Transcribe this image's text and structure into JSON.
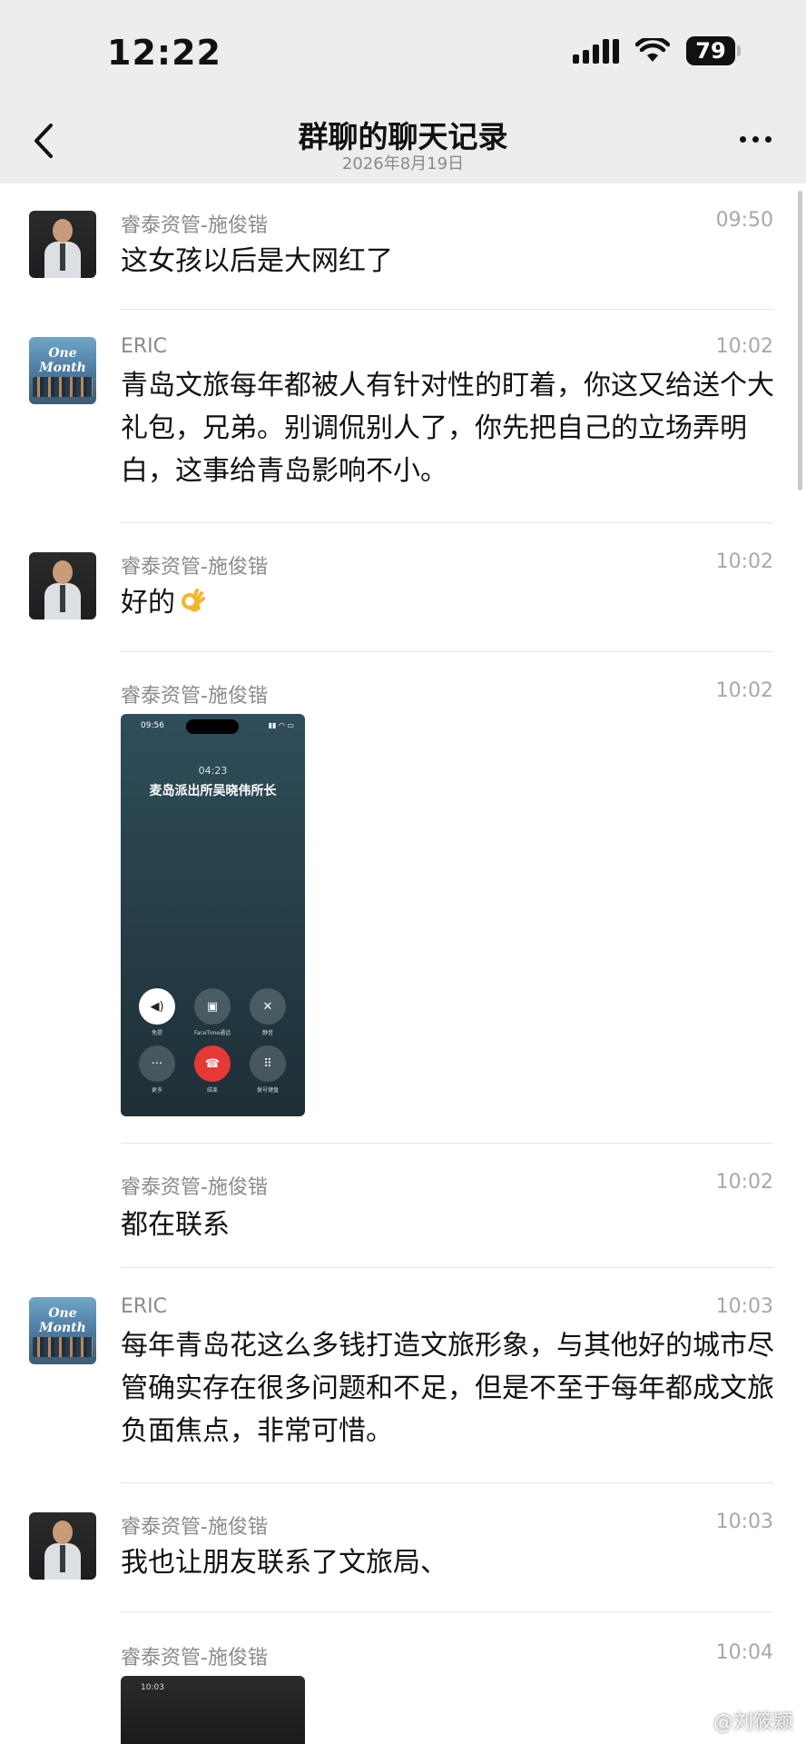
{
  "status_bar": {
    "time": "12:22",
    "battery": "79"
  },
  "nav": {
    "title": "群聊的聊天记录",
    "date": "2026年8月19日"
  },
  "messages": [
    {
      "sender": "睿泰资管-施俊锴",
      "time": "09:50",
      "text": "这女孩以后是大网红了"
    },
    {
      "sender": "ERIC",
      "time": "10:02",
      "text": "青岛文旅每年都被人有针对性的盯着，你这又给送个大礼包，兄弟。别调侃别人了，你先把自己的立场弄明白，这事给青岛影响不小。"
    },
    {
      "sender": "睿泰资管-施俊锴",
      "time": "10:02",
      "text": "好的",
      "emoji": "ok-hand-emoji"
    },
    {
      "sender": "睿泰资管-施俊锴",
      "time": "10:02",
      "image": {
        "status_time": "09:56",
        "call_duration": "04:23",
        "caller": "麦岛派出所吴晓伟所长",
        "buttons": [
          "免提",
          "FaceTime通话",
          "静音",
          "更多",
          "结束",
          "拨号键盘"
        ]
      }
    },
    {
      "sender": "睿泰资管-施俊锴",
      "time": "10:02",
      "text": "都在联系"
    },
    {
      "sender": "ERIC",
      "time": "10:03",
      "text": "每年青岛花这么多钱打造文旅形象，与其他好的城市尽管确实存在很多问题和不足，但是不至于每年都成文旅负面焦点，非常可惜。"
    },
    {
      "sender": "睿泰资管-施俊锴",
      "time": "10:03",
      "text": "我也让朋友联系了文旅局、"
    },
    {
      "sender": "睿泰资管-施俊锴",
      "time": "10:04",
      "image": {
        "status_time": "10:03"
      }
    }
  ],
  "watermark": "@刘筱颖",
  "colors": {
    "nav_bg": "#ededed",
    "end_call": "#e53935"
  }
}
